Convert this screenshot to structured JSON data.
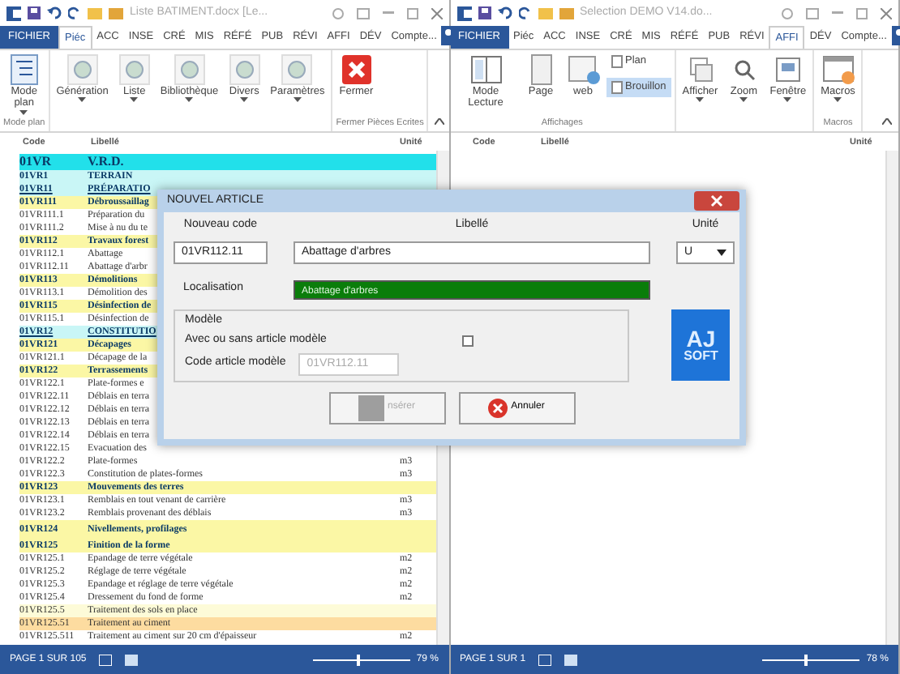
{
  "windows": [
    {
      "title": "Liste BATIMENT.docx [Le...",
      "account": "Compte...",
      "tabs": [
        {
          "label": "FICHIER",
          "kind": "file",
          "selected": false
        },
        {
          "label": "Piéc",
          "kind": "tab",
          "selected": true
        },
        {
          "label": "ACC",
          "kind": "tab",
          "selected": false
        },
        {
          "label": "INSE",
          "kind": "tab",
          "selected": false
        },
        {
          "label": "CRÉ",
          "kind": "tab",
          "selected": false
        },
        {
          "label": "MIS",
          "kind": "tab",
          "selected": false
        },
        {
          "label": "RÉFÉ",
          "kind": "tab",
          "selected": false
        },
        {
          "label": "PUB",
          "kind": "tab",
          "selected": false
        },
        {
          "label": "RÉVI",
          "kind": "tab",
          "selected": false
        },
        {
          "label": "AFFI",
          "kind": "tab",
          "selected": false
        },
        {
          "label": "DÉV",
          "kind": "tab",
          "selected": false
        }
      ],
      "ribbon": [
        {
          "label": "Mode plan",
          "buttons": [
            {
              "label": "Mode plan",
              "dropdown": true
            }
          ]
        },
        {
          "buttons": [
            {
              "label": "Génération",
              "dropdown": true
            },
            {
              "label": "Liste",
              "dropdown": true
            },
            {
              "label": "Bibliothèque",
              "dropdown": true
            },
            {
              "label": "Divers",
              "dropdown": true
            },
            {
              "label": "Paramètres",
              "dropdown": true
            }
          ]
        },
        {
          "label": "Fermer Pièces Ecrites",
          "buttons": [
            {
              "label": "Fermer",
              "dropdown": false
            }
          ]
        }
      ],
      "columns": [
        "Code",
        "Libellé",
        "Unité"
      ],
      "rows": [
        {
          "code": "01VR",
          "label": "V.R.D.",
          "kind": "chapter"
        },
        {
          "code": "01VR1",
          "label": "TERRAIN",
          "kind": "section"
        },
        {
          "code": "01VR11",
          "label": "PRÉPARATIO",
          "kind": "subsection"
        },
        {
          "code": "01VR111",
          "label": "Débroussaillag",
          "kind": "group"
        },
        {
          "code": "01VR111.1",
          "label": "Préparation du",
          "kind": "item"
        },
        {
          "code": "01VR111.2",
          "label": "Mise à nu du te",
          "kind": "item"
        },
        {
          "code": "01VR112",
          "label": "Travaux forest",
          "kind": "group"
        },
        {
          "code": "01VR112.1",
          "label": "Abattage",
          "kind": "item"
        },
        {
          "code": "01VR112.11",
          "label": "Abattage d'arbr",
          "kind": "item"
        },
        {
          "code": "01VR113",
          "label": "Démolitions",
          "kind": "group"
        },
        {
          "code": "01VR113.1",
          "label": "Démolition des",
          "kind": "item"
        },
        {
          "code": "01VR115",
          "label": "Désinfection de",
          "kind": "group"
        },
        {
          "code": "01VR115.1",
          "label": "Désinfection de",
          "kind": "item"
        },
        {
          "code": "01VR12",
          "label": "CONSTITUTIO",
          "kind": "subsection"
        },
        {
          "code": "01VR121",
          "label": "Décapages",
          "kind": "group"
        },
        {
          "code": "01VR121.1",
          "label": "Décapage de la",
          "kind": "item"
        },
        {
          "code": "01VR122",
          "label": "Terrassements",
          "kind": "group"
        },
        {
          "code": "01VR122.1",
          "label": "Plate-formes e",
          "kind": "item"
        },
        {
          "code": "01VR122.11",
          "label": "Déblais en terra",
          "kind": "item"
        },
        {
          "code": "01VR122.12",
          "label": "Déblais en terra",
          "kind": "item"
        },
        {
          "code": "01VR122.13",
          "label": "Déblais en terra",
          "kind": "item"
        },
        {
          "code": "01VR122.14",
          "label": "Déblais en terra",
          "kind": "item"
        },
        {
          "code": "01VR122.15",
          "label": "Evacuation des",
          "kind": "item"
        },
        {
          "code": "01VR122.2",
          "label": "Plate-formes",
          "unit": "m3",
          "kind": "item"
        },
        {
          "code": "01VR122.3",
          "label": "Constitution de plates-formes",
          "unit": "m3",
          "kind": "item"
        },
        {
          "code": "01VR123",
          "label": "Mouvements des terres",
          "kind": "group"
        },
        {
          "code": "01VR123.1",
          "label": "Remblais en tout venant de carrière",
          "unit": "m3",
          "kind": "item"
        },
        {
          "code": "01VR123.2",
          "label": "Remblais provenant des déblais",
          "unit": "m3",
          "kind": "item"
        },
        {
          "code": "01VR124",
          "label": "Nivellements, profilages",
          "kind": "group-tall"
        },
        {
          "code": "01VR125",
          "label": "Finition de la forme",
          "kind": "group"
        },
        {
          "code": "01VR125.1",
          "label": "Epandage de terre végétale",
          "unit": "m2",
          "kind": "item"
        },
        {
          "code": "01VR125.2",
          "label": "Réglage de terre végétale",
          "unit": "m2",
          "kind": "item"
        },
        {
          "code": "01VR125.3",
          "label": "Epandage et réglage de terre végétale",
          "unit": "m2",
          "kind": "item"
        },
        {
          "code": "01VR125.4",
          "label": "Dressement du fond de forme",
          "unit": "m2",
          "kind": "item"
        },
        {
          "code": "01VR125.5",
          "label": "Traitement des sols en place",
          "kind": "item-light"
        },
        {
          "code": "01VR125.51",
          "label": "Traitement au ciment",
          "kind": "item-orange"
        },
        {
          "code": "01VR125.511",
          "label": "Traitement au ciment sur 20 cm d'épaisseur",
          "unit": "m2",
          "kind": "item"
        }
      ],
      "status": {
        "page": "PAGE 1 SUR 105",
        "zoom": "79 %",
        "level": 0.45
      }
    },
    {
      "title": "Selection DEMO V14.do...",
      "account": "Compte...",
      "tabs": [
        {
          "label": "FICHIER",
          "kind": "file",
          "selected": false
        },
        {
          "label": "Piéc",
          "kind": "tab",
          "selected": false
        },
        {
          "label": "ACC",
          "kind": "tab",
          "selected": false
        },
        {
          "label": "INSE",
          "kind": "tab",
          "selected": false
        },
        {
          "label": "CRÉ",
          "kind": "tab",
          "selected": false
        },
        {
          "label": "MIS",
          "kind": "tab",
          "selected": false
        },
        {
          "label": "RÉFÉ",
          "kind": "tab",
          "selected": false
        },
        {
          "label": "PUB",
          "kind": "tab",
          "selected": false
        },
        {
          "label": "RÉVI",
          "kind": "tab",
          "selected": false
        },
        {
          "label": "AFFI",
          "kind": "tab",
          "selected": true
        },
        {
          "label": "DÉV",
          "kind": "tab",
          "selected": false
        }
      ],
      "ribbon": [
        {
          "label": "Affichages",
          "buttons": [
            {
              "label": "Mode Lecture",
              "dropdown": false
            },
            {
              "label": "Page",
              "dropdown": false
            },
            {
              "label": "web",
              "dropdown": false
            }
          ],
          "small_buttons": [
            {
              "label": "Plan",
              "selected": false
            },
            {
              "label": "Brouillon",
              "selected": true
            }
          ]
        },
        {
          "buttons": [
            {
              "label": "Afficher",
              "dropdown": true
            },
            {
              "label": "Zoom",
              "dropdown": true
            },
            {
              "label": "Fenêtre",
              "dropdown": true
            }
          ]
        },
        {
          "label": "Macros",
          "buttons": [
            {
              "label": "Macros",
              "dropdown": true
            }
          ]
        }
      ],
      "columns": [
        "Code",
        "Libellé",
        "Unité"
      ],
      "status": {
        "page": "PAGE 1 SUR 1",
        "zoom": "78 %",
        "level": 0.42
      }
    }
  ],
  "dialog": {
    "title": "NOUVEL ARTICLE",
    "code_label": "Nouveau code",
    "code_value": "01VR112.11",
    "label_label": "Libellé",
    "label_value": "Abattage d'arbres",
    "unit_label": "Unité",
    "unit_value": "U",
    "location_label": "Localisation",
    "location_value": "Abattage d'arbres",
    "model_group": "Modèle",
    "model_check": {
      "label": "Avec ou sans article modèle",
      "checked": false
    },
    "model_code_label": "Code article modèle",
    "model_code_value": "01VR112.11",
    "logo": [
      "AJ",
      "SOFT"
    ],
    "buttons": [
      {
        "label": "nsérer",
        "kind": "insert",
        "disabled": true
      },
      {
        "label": "Annuler",
        "kind": "cancel",
        "disabled": false
      }
    ]
  }
}
